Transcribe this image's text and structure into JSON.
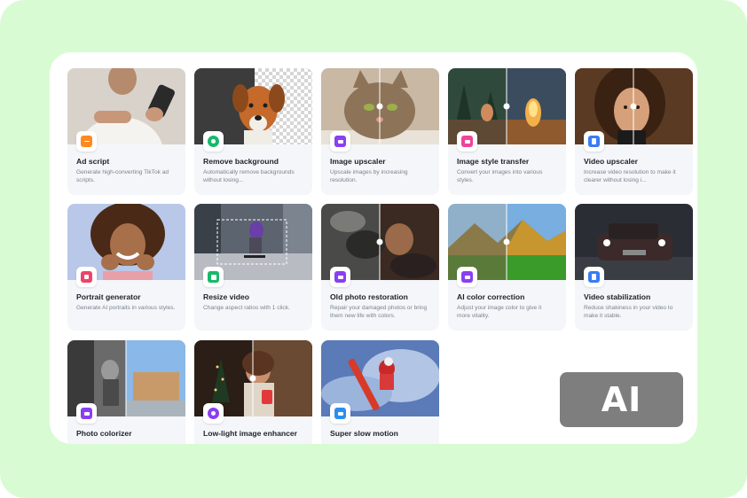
{
  "colors": {
    "backdrop": "#d9fbd3",
    "panel": "#ffffff",
    "card": "#f4f6f9",
    "badge": "#7e7e7e"
  },
  "badge": {
    "label": "AI"
  },
  "tools": [
    {
      "title": "Ad script",
      "desc": "Generate high-converting TikTok ad scripts.",
      "icon": "document-icon",
      "icon_color": "#ff8a1f"
    },
    {
      "title": "Remove background",
      "desc": "Automatically remove backgrounds without losing...",
      "icon": "remove-bg-icon",
      "icon_color": "#18b86a"
    },
    {
      "title": "Image upscaler",
      "desc": "Upscale images by increasing resolution.",
      "icon": "image-4k-icon",
      "icon_color": "#8a3ff2"
    },
    {
      "title": "Image style transfer",
      "desc": "Convert your images into various styles.",
      "icon": "style-transfer-icon",
      "icon_color": "#f0439a"
    },
    {
      "title": "Video upscaler",
      "desc": "Increase video resolution to make it clearer without losing i...",
      "icon": "video-upscale-icon",
      "icon_color": "#3a7bf5"
    },
    {
      "title": "Portrait generator",
      "desc": "Generate AI portraits in various styles.",
      "icon": "portrait-icon",
      "icon_color": "#f0436a"
    },
    {
      "title": "Resize video",
      "desc": "Change aspect ratios with 1 click.",
      "icon": "resize-icon",
      "icon_color": "#18b86a"
    },
    {
      "title": "Old photo restoration",
      "desc": "Repair your damaged photos or bring them new life with colors.",
      "icon": "restore-photo-icon",
      "icon_color": "#8a3ff2"
    },
    {
      "title": "AI color correction",
      "desc": "Adjust your image color to give it more vitality.",
      "icon": "color-correction-icon",
      "icon_color": "#8a3ff2"
    },
    {
      "title": "Video stabilization",
      "desc": "Reduce shakiness in your video to make it stable.",
      "icon": "stabilization-icon",
      "icon_color": "#3a7bf5"
    },
    {
      "title": "Photo colorizer",
      "desc": "",
      "icon": "colorizer-icon",
      "icon_color": "#8a3ff2"
    },
    {
      "title": "Low-light image enhancer",
      "desc": "",
      "icon": "moon-icon",
      "icon_color": "#8a3ff2"
    },
    {
      "title": "Super slow motion",
      "desc": "",
      "icon": "slow-motion-icon",
      "icon_color": "#2a8ff0"
    }
  ]
}
